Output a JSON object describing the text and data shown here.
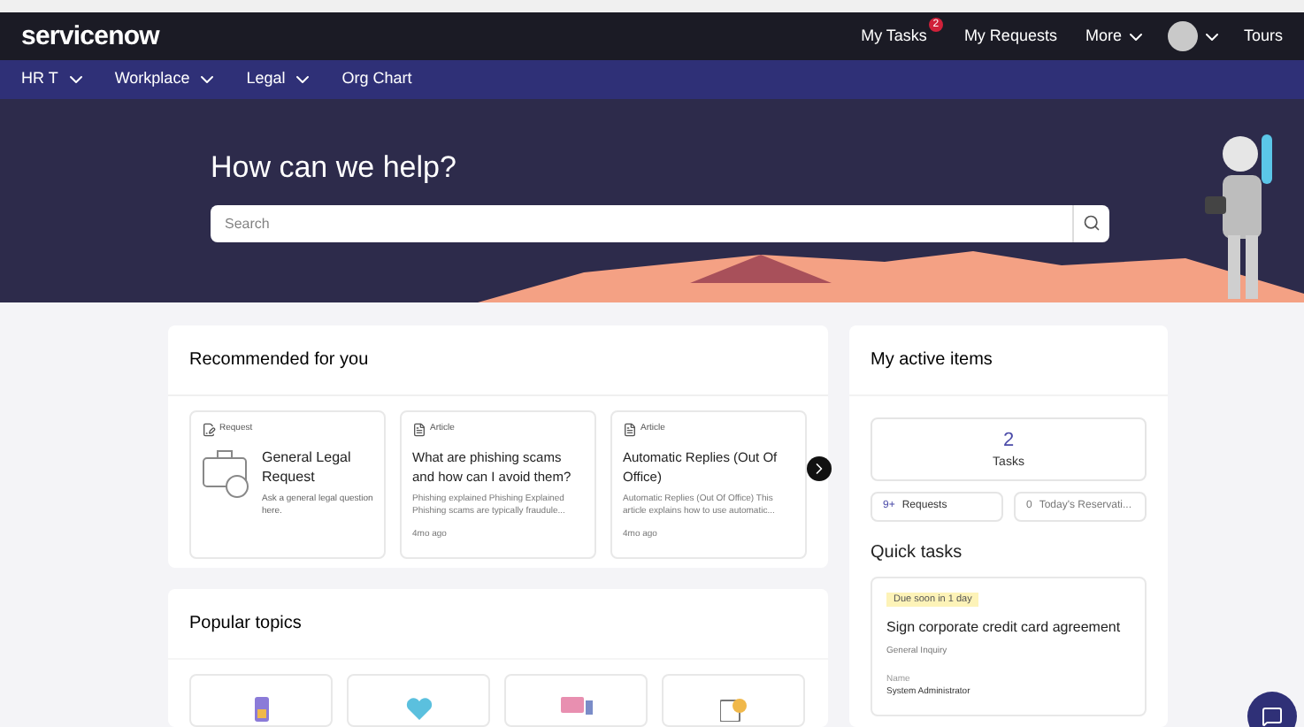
{
  "header": {
    "logo": "servicenow",
    "links": [
      {
        "label": "My Tasks",
        "badge": "2"
      },
      {
        "label": "My Requests"
      }
    ],
    "more": "More",
    "tours": "Tours"
  },
  "nav": [
    {
      "label": "HR T",
      "dropdown": true
    },
    {
      "label": "Workplace",
      "dropdown": true
    },
    {
      "label": "Legal",
      "dropdown": true
    },
    {
      "label": "Org Chart",
      "dropdown": false
    }
  ],
  "hero": {
    "title": "How can we help?",
    "search": {
      "placeholder": "Search"
    }
  },
  "recommended": {
    "title": "Recommended for you",
    "items": [
      {
        "kind": "request",
        "type": "Request",
        "title": "General Legal Request",
        "description": "Ask a general legal question here."
      },
      {
        "kind": "article",
        "type": "Article",
        "title": "What are phishing scams and how can I avoid them?",
        "description": "Phishing explained Phishing Explained Phishing scams are typically fraudule...",
        "time": "4mo ago"
      },
      {
        "kind": "article",
        "type": "Article",
        "title": "Automatic Replies (Out Of Office)",
        "description": "Automatic Replies (Out Of Office) This article explains how to use automatic...",
        "time": "4mo ago"
      }
    ]
  },
  "popular_topics": {
    "title": "Popular topics",
    "topics": [
      {
        "kind": "phone"
      },
      {
        "kind": "heart"
      },
      {
        "kind": "screen"
      },
      {
        "kind": "document"
      }
    ]
  },
  "active_items": {
    "title": "My active items",
    "tasks": {
      "count": "2",
      "label": "Tasks"
    },
    "requests": {
      "count": "9+",
      "label": "Requests"
    },
    "reservations": {
      "count": "0",
      "label": "Today's Reservati..."
    }
  },
  "quick_tasks": {
    "title": "Quick tasks",
    "task": {
      "due": "Due soon in 1 day",
      "title": "Sign corporate credit card agreement",
      "type": "General Inquiry",
      "name_label": "Name",
      "name": "System Administrator"
    }
  }
}
